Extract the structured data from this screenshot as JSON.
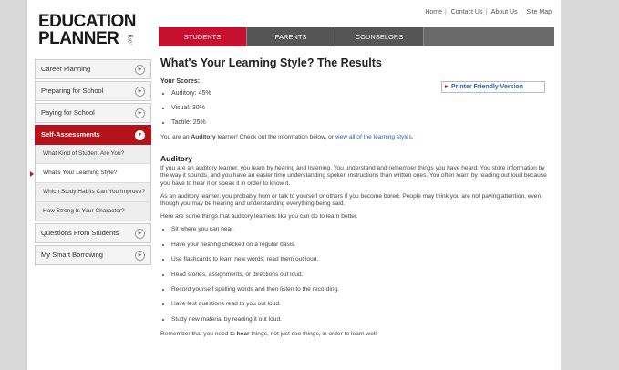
{
  "logo": {
    "line1": "EDUCATION",
    "line2": "PLANNER",
    "org": ".org"
  },
  "util_links": [
    "Home",
    "Contact Us",
    "About Us",
    "Site Map"
  ],
  "tabs": [
    "STUDENTS",
    "PARENTS",
    "COUNSELORS"
  ],
  "sidebar": {
    "items": [
      {
        "label": "Career Planning"
      },
      {
        "label": "Preparing for School"
      },
      {
        "label": "Paying for School"
      },
      {
        "label": "Self-Assessments"
      }
    ],
    "subitems": [
      "What Kind of Student Are You?",
      "What's Your Learning Style?",
      "Which Study Habits Can You Improve?",
      "How Strong Is Your Character?"
    ],
    "items_after": [
      {
        "label": "Questions From Students"
      },
      {
        "label": "My Smart Borrowing"
      }
    ]
  },
  "main": {
    "title": "What's Your Learning Style? The Results",
    "scores_label": "Your Scores:",
    "print_label": "Printer Friendly Version",
    "scores": [
      "Auditory: 45%",
      "Visual: 30%",
      "Tactile: 25%"
    ],
    "result_pre": "You are an ",
    "result_bold": "Auditory",
    "result_mid": " learner! Check out the information below, or ",
    "result_link": "view all of the learning styles",
    "result_post": ".",
    "section_heading": "Auditory",
    "para1": "If you are an auditory learner, you learn by hearing and listening. You understand and remember things you have heard. You store information by the way it sounds, and you have an easier time understanding spoken instructions than written ones. You often learn by reading out loud because you have to hear it or speak it in order to know it.",
    "para2": "As an auditory learner, you probably hum or talk to yourself or others if you become bored. People may think you are not paying attention, even though you may be hearing and understanding everything being said.",
    "para3": "Here are some things that auditory learners like you can do to learn better.",
    "tips": [
      "Sit where you can hear.",
      "Have your hearing checked on a regular basis.",
      "Use flashcards to learn new words; read them out loud.",
      "Read stories, assignments, or directions out loud.",
      "Record yourself spelling words and then listen to the recording.",
      "Have test questions read to you out loud.",
      "Study new material by reading it out loud."
    ],
    "closing_pre": "Remember that you need to ",
    "closing_bold": "hear",
    "closing_post": " things, not just see things, in order to learn well."
  }
}
